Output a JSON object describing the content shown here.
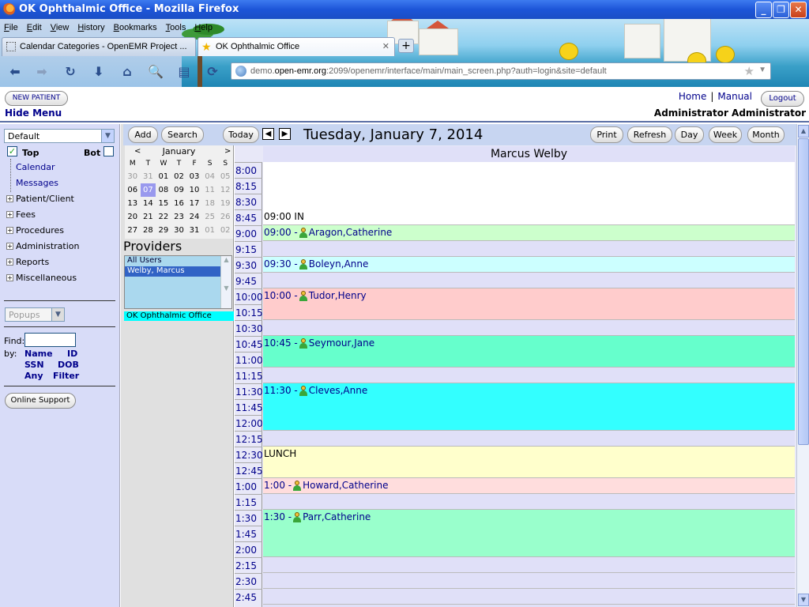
{
  "window": {
    "title": "OK Ophthalmic Office - Mozilla Firefox",
    "minimize": "_",
    "maximize": "❐",
    "close": "✕"
  },
  "menubar": [
    "File",
    "Edit",
    "View",
    "History",
    "Bookmarks",
    "Tools",
    "Help"
  ],
  "tabs": [
    {
      "label": "Calendar Categories - OpenEMR Project ...",
      "active": false
    },
    {
      "label": "OK Ophthalmic Office",
      "active": true
    }
  ],
  "newtab_label": "+",
  "url": {
    "prefix": "demo.",
    "host": "open-emr.org",
    "rest": ":2099/openemr/interface/main/main_screen.php?auth=login&site=default"
  },
  "header": {
    "new_patient": "NEW PATIENT",
    "hide_menu": "Hide Menu",
    "home": "Home",
    "separator": "|",
    "manual": "Manual",
    "logout": "Logout",
    "user": "Administrator Administrator"
  },
  "leftnav": {
    "layout_select": "Default",
    "top_label": "Top",
    "bot_label": "Bot",
    "top_checked": true,
    "bot_checked": false,
    "leaves": [
      "Calendar",
      "Messages"
    ],
    "tree": [
      "Patient/Client",
      "Fees",
      "Procedures",
      "Administration",
      "Reports",
      "Miscellaneous"
    ],
    "popups_select": "Popups",
    "find_label": "Find:",
    "by_label": "by:",
    "find_links": [
      "Name",
      "ID",
      "SSN",
      "DOB",
      "Any",
      "Filter"
    ],
    "online_support": "Online Support"
  },
  "minical": {
    "prev": "<",
    "next": ">",
    "month": "January",
    "weekdays": [
      "M",
      "T",
      "W",
      "T",
      "F",
      "S",
      "S"
    ],
    "weeks": [
      [
        {
          "d": "30",
          "dim": true
        },
        {
          "d": "31",
          "dim": true
        },
        {
          "d": "01"
        },
        {
          "d": "02"
        },
        {
          "d": "03"
        },
        {
          "d": "04",
          "dim": true
        },
        {
          "d": "05",
          "dim": true
        }
      ],
      [
        {
          "d": "06"
        },
        {
          "d": "07",
          "today": true
        },
        {
          "d": "08"
        },
        {
          "d": "09"
        },
        {
          "d": "10"
        },
        {
          "d": "11",
          "dim": true
        },
        {
          "d": "12",
          "dim": true
        }
      ],
      [
        {
          "d": "13"
        },
        {
          "d": "14"
        },
        {
          "d": "15"
        },
        {
          "d": "16"
        },
        {
          "d": "17"
        },
        {
          "d": "18",
          "dim": true
        },
        {
          "d": "19",
          "dim": true
        }
      ],
      [
        {
          "d": "20"
        },
        {
          "d": "21"
        },
        {
          "d": "22"
        },
        {
          "d": "23"
        },
        {
          "d": "24"
        },
        {
          "d": "25",
          "dim": true
        },
        {
          "d": "26",
          "dim": true
        }
      ],
      [
        {
          "d": "27"
        },
        {
          "d": "28"
        },
        {
          "d": "29"
        },
        {
          "d": "30"
        },
        {
          "d": "31"
        },
        {
          "d": "01",
          "dim": true
        },
        {
          "d": "02",
          "dim": true
        }
      ]
    ]
  },
  "providers": {
    "title": "Providers",
    "options": [
      {
        "label": "All Users",
        "selected": false
      },
      {
        "label": "Welby, Marcus",
        "selected": true
      }
    ],
    "facility": "OK Ophthalmic Office"
  },
  "calendar": {
    "buttons_left": [
      "Add",
      "Search"
    ],
    "today": "Today",
    "prev_icon": "◀",
    "next_icon": "▶",
    "date": "Tuesday, January 7, 2014",
    "buttons_right": [
      "Print",
      "Refresh",
      "Day",
      "Week",
      "Month"
    ],
    "provider": "Marcus Welby",
    "times": [
      "8:00",
      "8:15",
      "8:30",
      "8:45",
      "9:00",
      "9:15",
      "9:30",
      "9:45",
      "10:00",
      "10:15",
      "10:30",
      "10:45",
      "11:00",
      "11:15",
      "11:30",
      "11:45",
      "12:00",
      "12:15",
      "12:30",
      "12:45",
      "1:00",
      "1:15",
      "1:30",
      "1:45",
      "2:00",
      "2:15",
      "2:30",
      "2:45"
    ],
    "events": [
      {
        "time": "09:00",
        "text": "IN",
        "patient": false,
        "color": "#ffffff",
        "start": 3,
        "span": 1
      },
      {
        "time": "09:00",
        "text": "Aragon,Catherine",
        "patient": true,
        "color": "#ccffcc",
        "start": 4,
        "span": 1
      },
      {
        "time": "09:30",
        "text": "Boleyn,Anne",
        "patient": true,
        "color": "#ccffff",
        "start": 6,
        "span": 1
      },
      {
        "time": "10:00",
        "text": "Tudor,Henry",
        "patient": true,
        "color": "#ffcccc",
        "start": 8,
        "span": 2
      },
      {
        "time": "10:45",
        "text": "Seymour,Jane",
        "patient": true,
        "color": "#66ffcc",
        "start": 11,
        "span": 2
      },
      {
        "time": "11:30",
        "text": "Cleves,Anne",
        "patient": true,
        "color": "#33ffff",
        "start": 14,
        "span": 3
      },
      {
        "time": "",
        "text": "LUNCH",
        "patient": false,
        "color": "#ffffcc",
        "start": 18,
        "span": 2
      },
      {
        "time": "1:00",
        "text": "Howard,Catherine",
        "patient": true,
        "color": "#ffdddd",
        "start": 20,
        "span": 1
      },
      {
        "time": "1:30",
        "text": "Parr,Catherine",
        "patient": true,
        "color": "#99ffcc",
        "start": 22,
        "span": 3
      }
    ],
    "free_slot_color": "#e0e0f8",
    "open_slot_color": "#ffffff"
  }
}
